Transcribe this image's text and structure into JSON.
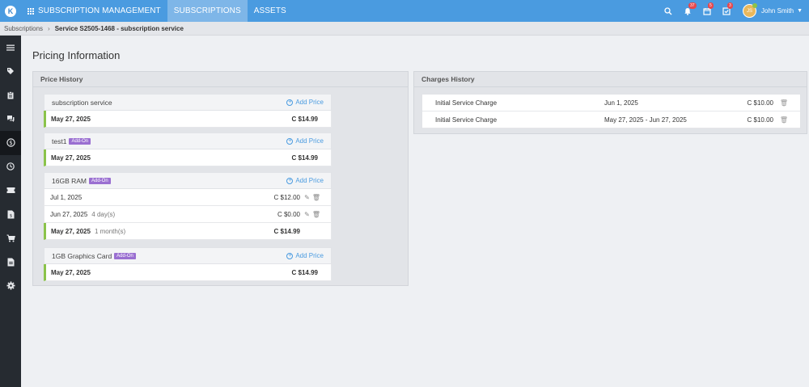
{
  "topbar": {
    "logo": "K",
    "app_title": "SUBSCRIPTION MANAGEMENT",
    "tabs": [
      {
        "label": "SUBSCRIPTIONS",
        "active": true
      },
      {
        "label": "ASSETS",
        "active": false
      }
    ],
    "icons": [
      {
        "name": "search-icon",
        "badge": ""
      },
      {
        "name": "bell-icon",
        "badge": "37"
      },
      {
        "name": "calendar-icon",
        "badge": "5"
      },
      {
        "name": "tasks-icon",
        "badge": "3"
      }
    ],
    "user": {
      "initials": "JS",
      "name": "John Smith"
    }
  },
  "breadcrumb": {
    "parent": "Subscriptions",
    "current": "Service S2505-1468 - subscription service"
  },
  "sidebar": {
    "items": [
      "menu-icon",
      "tags-icon",
      "clipboard-icon",
      "chat-icon",
      "dollar-icon",
      "clock-icon",
      "ticket-icon",
      "invoice-icon",
      "cart-icon",
      "document-icon",
      "settings-icon"
    ],
    "active_index": 4
  },
  "page": {
    "title": "Pricing Information"
  },
  "price_history": {
    "title": "Price History",
    "add_price_label": "Add Price",
    "addon_label": "Add-On",
    "groups": [
      {
        "name": "subscription service",
        "addon": false,
        "rows": [
          {
            "date": "May 27, 2025",
            "note": "",
            "amount": "C $14.99",
            "current": true,
            "editable": false
          }
        ]
      },
      {
        "name": "test1",
        "addon": true,
        "rows": [
          {
            "date": "May 27, 2025",
            "note": "",
            "amount": "C $14.99",
            "current": true,
            "editable": false
          }
        ]
      },
      {
        "name": "16GB RAM",
        "addon": true,
        "rows": [
          {
            "date": "Jul 1, 2025",
            "note": "",
            "amount": "C $12.00",
            "current": false,
            "editable": true
          },
          {
            "date": "Jun 27, 2025",
            "note": "4 day(s)",
            "amount": "C $0.00",
            "current": false,
            "editable": true
          },
          {
            "date": "May 27, 2025",
            "note": "1 month(s)",
            "amount": "C $14.99",
            "current": true,
            "editable": false
          }
        ]
      },
      {
        "name": "1GB Graphics Card",
        "addon": true,
        "rows": [
          {
            "date": "May 27, 2025",
            "note": "",
            "amount": "C $14.99",
            "current": true,
            "editable": false
          }
        ]
      }
    ]
  },
  "charges_history": {
    "title": "Charges History",
    "rows": [
      {
        "description": "Initial Service Charge",
        "period": "Jun 1, 2025",
        "amount": "C $10.00"
      },
      {
        "description": "Initial Service Charge",
        "period": "May 27, 2025 - Jun 27, 2025",
        "amount": "C $10.00"
      }
    ]
  }
}
